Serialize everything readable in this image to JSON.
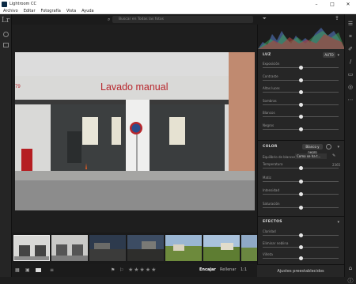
{
  "app": {
    "title": "Lightroom CC"
  },
  "window_controls": {
    "minimize": "–",
    "maximize": "□",
    "close": "✕"
  },
  "menu": [
    "Archivo",
    "Editar",
    "Fotografía",
    "Vista",
    "Ayuda"
  ],
  "left_rail": {
    "logo": "Lr"
  },
  "topbar": {
    "search_placeholder": "Buscar en Todas las fotos"
  },
  "photo": {
    "sign_text": "Lavado manual",
    "side_text": "79"
  },
  "panel": {
    "luz": {
      "title": "LUZ",
      "auto_label": "AUTO",
      "sliders": [
        {
          "label": "Exposición",
          "value": 0.5
        },
        {
          "label": "Contraste",
          "value": 0.5
        },
        {
          "label": "Altas luces",
          "value": 0.5
        },
        {
          "label": "Sombras",
          "value": 0.5
        },
        {
          "label": "Blancos",
          "value": 0.5
        },
        {
          "label": "Negros",
          "value": 0.5
        }
      ]
    },
    "color": {
      "title": "COLOR",
      "bw_label": "Blanco y negro",
      "wb_label": "Equilibrio de blancos",
      "wb_value": "Como se ha t...",
      "temp_value": "2365",
      "sliders": [
        {
          "label": "Temperatura",
          "value": 0.5
        },
        {
          "label": "Matiz",
          "value": 0.5
        },
        {
          "label": "Intensidad",
          "value": 0.5
        },
        {
          "label": "Saturación",
          "value": 0.5
        }
      ]
    },
    "efectos": {
      "title": "EFECTOS",
      "sliders": [
        {
          "label": "Claridad",
          "value": 0.5
        },
        {
          "label": "Eliminar neblina",
          "value": 0.5
        },
        {
          "label": "Viñeta",
          "value": 0.5
        }
      ]
    }
  },
  "bottombar": {
    "fit": "Encajar",
    "fill": "Rellenar",
    "ratio": "1:1",
    "presets": "Ajustes preestablecidos",
    "stars": "★★★★★"
  },
  "filmstrip": {
    "count": 7
  }
}
